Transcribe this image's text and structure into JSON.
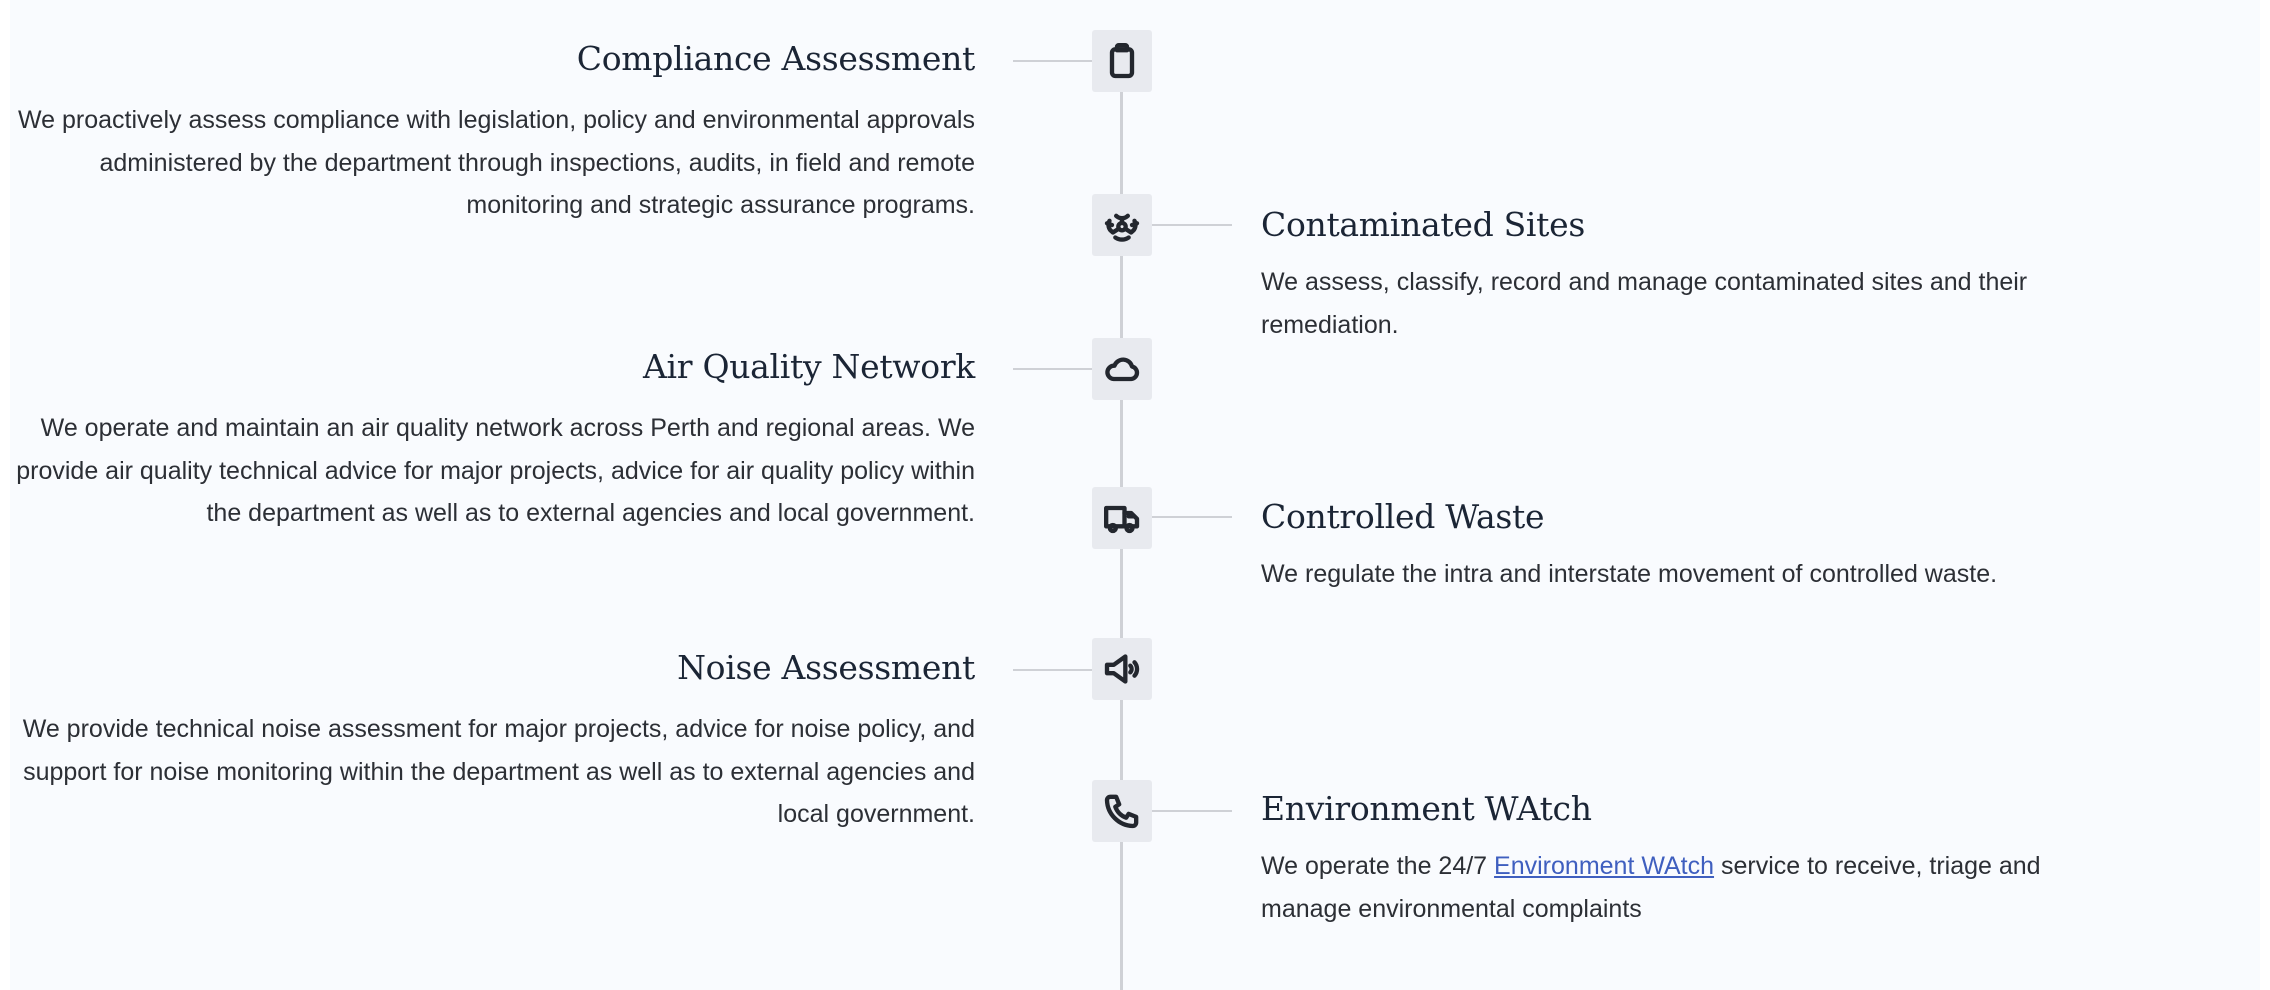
{
  "services": [
    {
      "side": "left",
      "icon": "clipboard-icon",
      "title": "Compliance Assessment",
      "description": "We proactively assess compliance with legislation, policy and environmental approvals administered by the department through inspections, audits, in field and remote monitoring and strategic assurance programs."
    },
    {
      "side": "right",
      "icon": "biohazard-icon",
      "title": "Contaminated Sites",
      "description": "We assess, classify, record and manage contaminated sites and their remediation."
    },
    {
      "side": "left",
      "icon": "cloud-icon",
      "title": "Air Quality Network",
      "description": "We operate and maintain an air quality network across Perth and regional areas. We provide air quality technical advice for major projects, advice for air quality policy within the department as well as to external agencies and local government."
    },
    {
      "side": "right",
      "icon": "truck-icon",
      "title": "Controlled Waste",
      "description": "We regulate the intra and interstate movement of controlled waste."
    },
    {
      "side": "left",
      "icon": "speaker-icon",
      "title": "Noise Assessment",
      "description": "We provide technical noise assessment for major projects, advice for noise policy, and support for noise monitoring within the department as well as to external agencies and local government."
    },
    {
      "side": "right",
      "icon": "phone-icon",
      "title": "Environment WAtch",
      "description_before": "We operate the 24/7 ",
      "link_text": "Environment WAtch",
      "description_after": " service to receive, triage and manage environmental complaints"
    }
  ]
}
